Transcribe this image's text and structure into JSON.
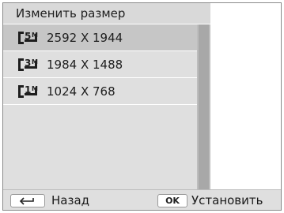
{
  "header": {
    "title": "Изменить размер"
  },
  "options": [
    {
      "label": "2592 X 1944",
      "icon": "5m-resolution-icon",
      "badge": "5M",
      "selected": true
    },
    {
      "label": "1984 X 1488",
      "icon": "3m-resolution-icon",
      "badge": "3M",
      "selected": false
    },
    {
      "label": "1024 X 768",
      "icon": "1m-resolution-icon",
      "badge": "1M",
      "selected": false
    }
  ],
  "footer": {
    "back_label": "Назад",
    "back_icon": "return-arrow-icon",
    "ok_key": "OK",
    "set_label": "Установить"
  },
  "colors": {
    "panel": "#dfdfdf",
    "selected_row": "#c6c6c6",
    "scrollbar": "#bdbdbd"
  }
}
